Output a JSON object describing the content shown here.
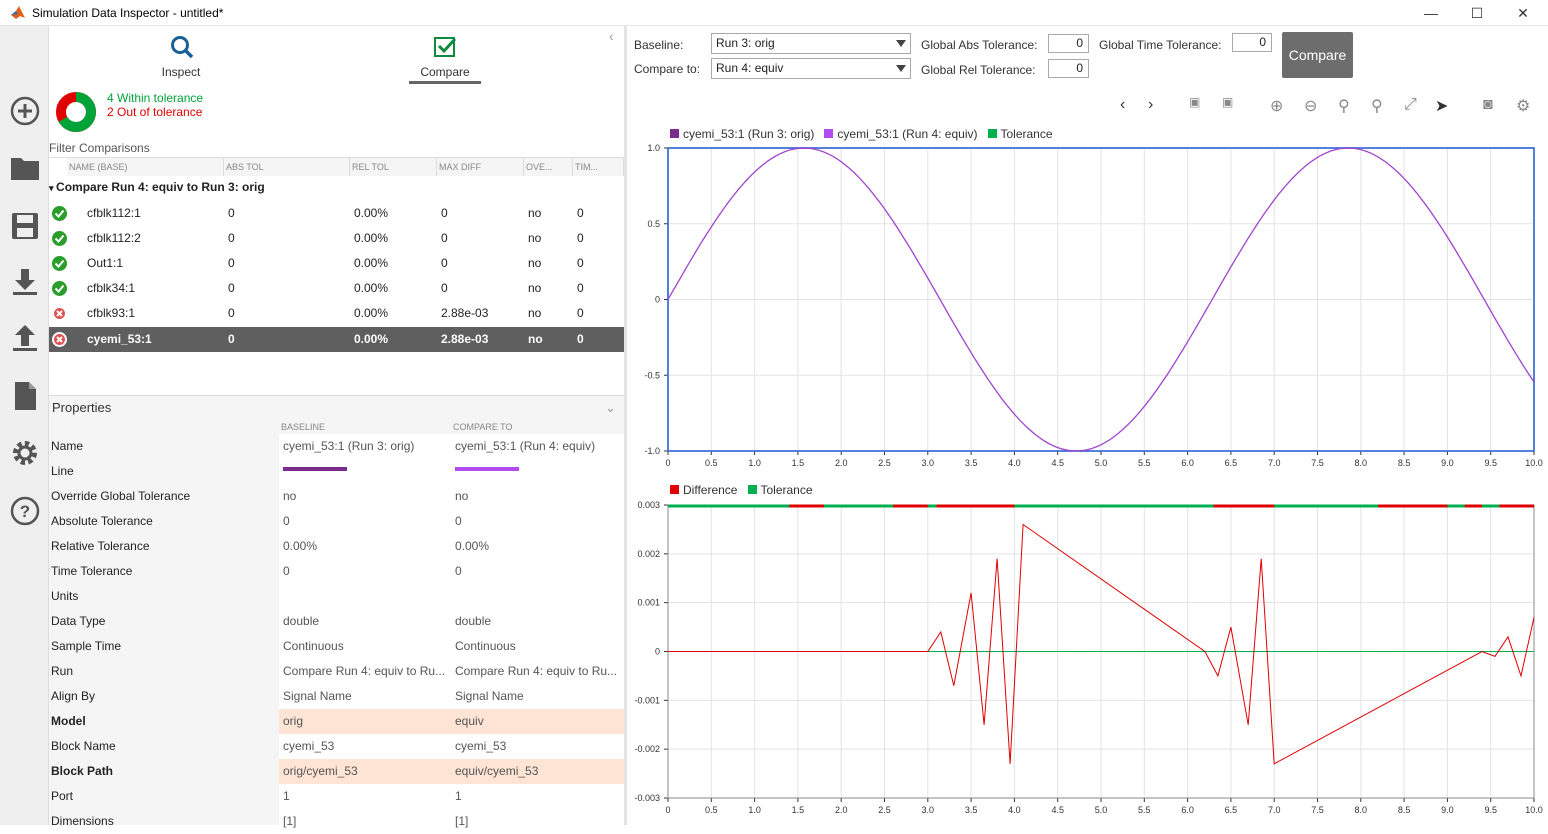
{
  "window": {
    "title": "Simulation Data Inspector - untitled*"
  },
  "tabs": [
    {
      "label": "Inspect"
    },
    {
      "label": "Compare"
    }
  ],
  "summary": {
    "within": "4 Within tolerance",
    "out": "2 Out of tolerance",
    "within_count": 4,
    "out_count": 2,
    "within_color": "#00a33a",
    "out_color": "#e00000"
  },
  "filter_label": "Filter Comparisons",
  "grid": {
    "headers": [
      "NAME (BASE)",
      "ABS TOL",
      "REL TOL",
      "MAX DIFF",
      "OVE...",
      "TIM..."
    ],
    "group": "Compare Run 4: equiv to Run 3: orig",
    "rows": [
      {
        "status": "pass",
        "name": "cfblk112:1",
        "abs": "0",
        "rel": "0.00%",
        "max": "0",
        "ove": "no",
        "tim": "0"
      },
      {
        "status": "pass",
        "name": "cfblk112:2",
        "abs": "0",
        "rel": "0.00%",
        "max": "0",
        "ove": "no",
        "tim": "0"
      },
      {
        "status": "pass",
        "name": "Out1:1",
        "abs": "0",
        "rel": "0.00%",
        "max": "0",
        "ove": "no",
        "tim": "0"
      },
      {
        "status": "pass",
        "name": "cfblk34:1",
        "abs": "0",
        "rel": "0.00%",
        "max": "0",
        "ove": "no",
        "tim": "0"
      },
      {
        "status": "fail",
        "name": "cfblk93:1",
        "abs": "0",
        "rel": "0.00%",
        "max": "2.88e-03",
        "ove": "no",
        "tim": "0"
      },
      {
        "status": "fail",
        "name": "cyemi_53:1",
        "abs": "0",
        "rel": "0.00%",
        "max": "2.88e-03",
        "ove": "no",
        "tim": "0",
        "selected": true
      }
    ]
  },
  "properties": {
    "title": "Properties",
    "col_baseline": "BASELINE",
    "col_compare": "COMPARE TO",
    "rows": [
      {
        "name": "Name",
        "base": "cyemi_53:1 (Run 3: orig)",
        "cmp": "cyemi_53:1 (Run 4: equiv)"
      },
      {
        "name": "Line",
        "base": "",
        "cmp": "",
        "line": true
      },
      {
        "name": "Override Global Tolerance",
        "base": "no",
        "cmp": "no"
      },
      {
        "name": "Absolute Tolerance",
        "base": "0",
        "cmp": "0"
      },
      {
        "name": "Relative Tolerance",
        "base": "0.00%",
        "cmp": "0.00%"
      },
      {
        "name": "Time Tolerance",
        "base": "0",
        "cmp": "0"
      },
      {
        "name": "Units",
        "base": "",
        "cmp": ""
      },
      {
        "name": "Data Type",
        "base": "double",
        "cmp": "double"
      },
      {
        "name": "Sample Time",
        "base": "Continuous",
        "cmp": "Continuous"
      },
      {
        "name": "Run",
        "base": "Compare Run 4: equiv to Ru...",
        "cmp": "Compare Run 4: equiv to Ru..."
      },
      {
        "name": "Align By",
        "base": "Signal Name",
        "cmp": "Signal Name"
      },
      {
        "name": "Model",
        "base": "orig",
        "cmp": "equiv",
        "hl": true
      },
      {
        "name": "Block Name",
        "base": "cyemi_53",
        "cmp": "cyemi_53"
      },
      {
        "name": "Block Path",
        "base": "orig/cyemi_53",
        "cmp": "equiv/cyemi_53",
        "hl": true
      },
      {
        "name": "Port",
        "base": "1",
        "cmp": "1"
      },
      {
        "name": "Dimensions",
        "base": "[1]",
        "cmp": "[1]"
      }
    ]
  },
  "settings": {
    "baseline_label": "Baseline:",
    "baseline_value": "Run 3: orig",
    "compare_label": "Compare to:",
    "compare_value": "Run 4: equiv",
    "abs_label": "Global Abs Tolerance:",
    "abs_value": "0",
    "rel_label": "Global Rel Tolerance:",
    "rel_value": "0",
    "time_label": "Global Time Tolerance:",
    "time_value": "0",
    "compare_button": "Compare"
  },
  "colors": {
    "baseline": "#7b2d8e",
    "compare": "#b04bf0",
    "tolerance": "#00b050",
    "difference": "#e00000",
    "plot_border": "#3a6fd8",
    "selected_row": "#5f5f5f"
  },
  "chart_data": [
    {
      "type": "line",
      "legend": [
        "cyemi_53:1 (Run 3: orig)",
        "cyemi_53:1 (Run 4: equiv)",
        "Tolerance"
      ],
      "xlim": [
        0,
        10
      ],
      "ylim": [
        -1,
        1
      ],
      "xticks": [
        "0",
        "0.5",
        "1.0",
        "1.5",
        "2.0",
        "2.5",
        "3.0",
        "3.5",
        "4.0",
        "4.5",
        "5.0",
        "5.5",
        "6.0",
        "6.5",
        "7.0",
        "7.5",
        "8.0",
        "8.5",
        "9.0",
        "9.5",
        "10.0"
      ],
      "yticks": [
        "1.0",
        "0.5",
        "0",
        "-0.5",
        "-1.0"
      ],
      "series": [
        {
          "name": "cyemi_53:1 (Run 3: orig)",
          "function": "sin(x)"
        },
        {
          "name": "cyemi_53:1 (Run 4: equiv)",
          "function": "sin(x)"
        }
      ],
      "grid": true
    },
    {
      "type": "line",
      "legend": [
        "Difference",
        "Tolerance"
      ],
      "xlim": [
        0,
        10
      ],
      "ylim": [
        -0.003,
        0.003
      ],
      "xticks": [
        "0",
        "0.5",
        "1.0",
        "1.5",
        "2.0",
        "2.5",
        "3.0",
        "3.5",
        "4.0",
        "4.5",
        "5.0",
        "5.5",
        "6.0",
        "6.5",
        "7.0",
        "7.5",
        "8.0",
        "8.5",
        "9.0",
        "9.5",
        "10.0"
      ],
      "yticks": [
        "0.003",
        "0.002",
        "0.001",
        "0",
        "-0.001",
        "-0.002",
        "-0.003"
      ],
      "series": [
        {
          "name": "Difference",
          "x": [
            0,
            3.0,
            3.15,
            3.3,
            3.5,
            3.65,
            3.8,
            3.95,
            4.1,
            6.2,
            6.35,
            6.5,
            6.7,
            6.85,
            7.0,
            9.4,
            9.55,
            9.7,
            9.85,
            10.0
          ],
          "y": [
            0,
            0,
            0.0004,
            -0.0007,
            0.0012,
            -0.0015,
            0.0019,
            -0.0023,
            0.0026,
            0,
            -0.0005,
            0.0005,
            -0.0015,
            0.0019,
            -0.0023,
            0,
            -0.0001,
            0.0003,
            -0.0005,
            0.0007
          ]
        },
        {
          "name": "Tolerance",
          "y": [
            0
          ]
        }
      ],
      "out_of_tolerance_intervals": [
        [
          1.4,
          1.8
        ],
        [
          2.6,
          3.0
        ],
        [
          3.1,
          4.0
        ],
        [
          6.3,
          7.0
        ],
        [
          8.2,
          9.0
        ],
        [
          9.2,
          9.4
        ],
        [
          9.6,
          10.0
        ]
      ],
      "grid": true
    }
  ]
}
